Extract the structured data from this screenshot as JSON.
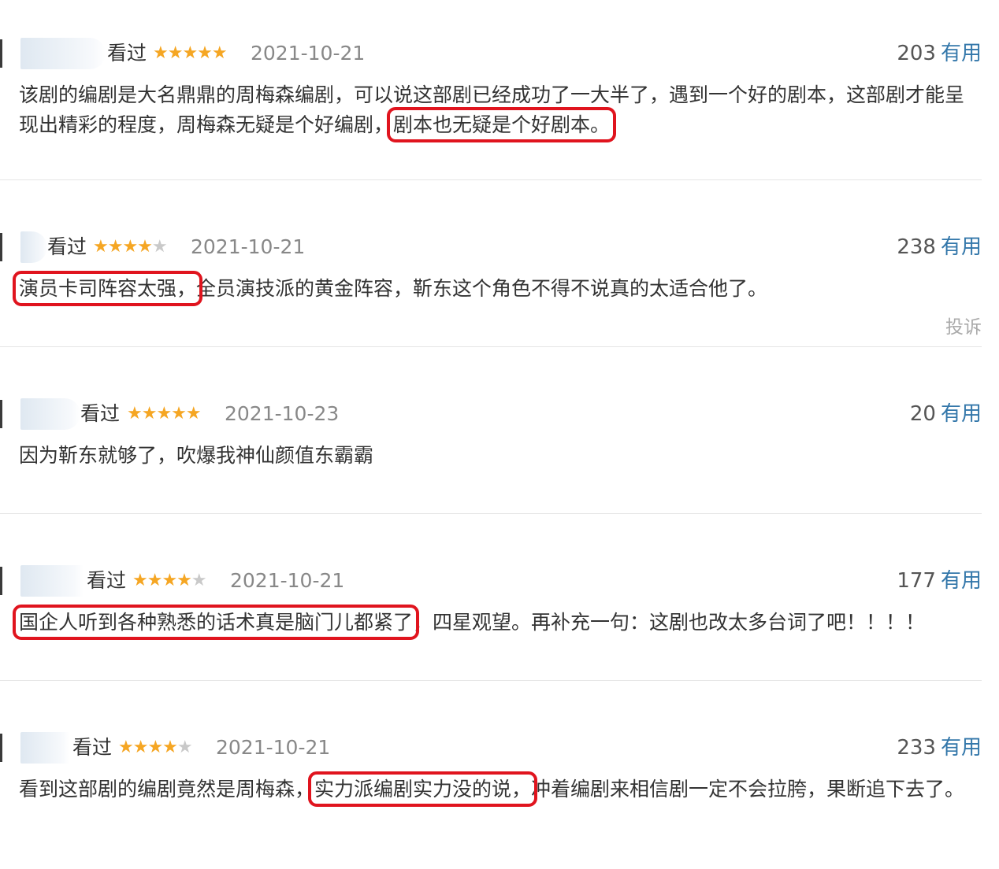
{
  "reviews": [
    {
      "watched": "看过",
      "stars": "★★★★★",
      "stars_off": "",
      "date": "2021-10-21",
      "votes": "203",
      "vote_label": "有用",
      "text_before": "该剧的编剧是大名鼎鼎的周梅森编剧，可以说这部剧已经成功了一大半了，遇到一个好的剧本，这部剧才能呈现出精彩的程度，周梅森无疑是个好编剧，",
      "text_highlight": "剧本也无疑是个好剧本。",
      "text_after": ""
    },
    {
      "watched": "看过",
      "stars": "★★★★",
      "stars_off": "★",
      "date": "2021-10-21",
      "votes": "238",
      "vote_label": "有用",
      "text_before": "",
      "text_highlight": "演员卡司阵容太强，",
      "text_after": "全员演技派的黄金阵容，靳东这个角色不得不说真的太适合他了。",
      "report": "投诉"
    },
    {
      "watched": "看过",
      "stars": "★★★★★",
      "stars_off": "",
      "date": "2021-10-23",
      "votes": "20",
      "vote_label": "有用",
      "text_before": "因为靳东就够了，吹爆我神仙颜值东霸霸",
      "text_highlight": "",
      "text_after": ""
    },
    {
      "watched": "看过",
      "stars": "★★★★",
      "stars_off": "★",
      "date": "2021-10-21",
      "votes": "177",
      "vote_label": "有用",
      "text_before": "",
      "text_highlight": "国企人听到各种熟悉的话术真是脑门儿都紧了",
      "text_after": "，四星观望。再补充一句：这剧也改太多台词了吧！！！！"
    },
    {
      "watched": "看过",
      "stars": "★★★★",
      "stars_off": "★",
      "date": "2021-10-21",
      "votes": "233",
      "vote_label": "有用",
      "text_before": "看到这部剧的编剧竟然是周梅森，",
      "text_highlight": "实力派编剧实力没的说，",
      "text_after": "冲着编剧来相信剧一定不会拉胯，果断追下去了。"
    }
  ]
}
